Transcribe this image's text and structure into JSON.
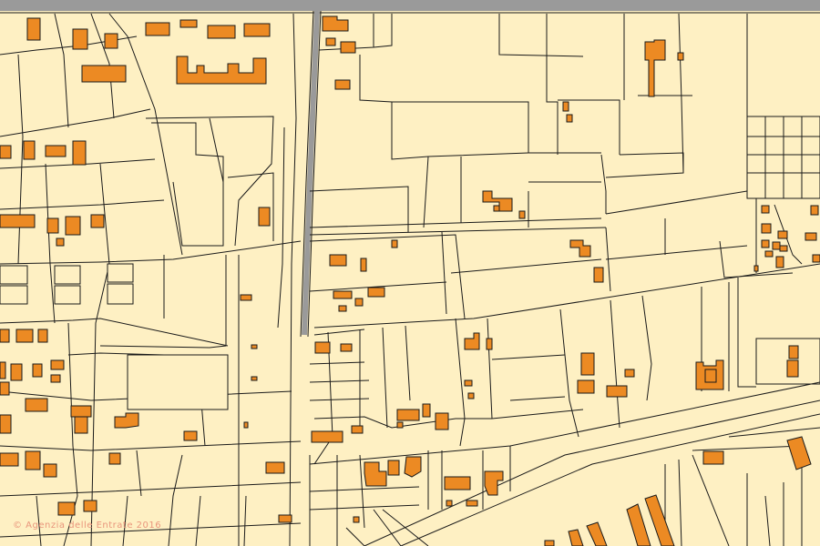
{
  "map": {
    "attribution": "© Agenzia delle Entrate 2016",
    "colors": {
      "background": "#fef0c3",
      "building": "#ec8a23",
      "parcel_outline": "#1a1a1a",
      "road": "#9a9a9a",
      "attribution": "#e9957c"
    }
  }
}
